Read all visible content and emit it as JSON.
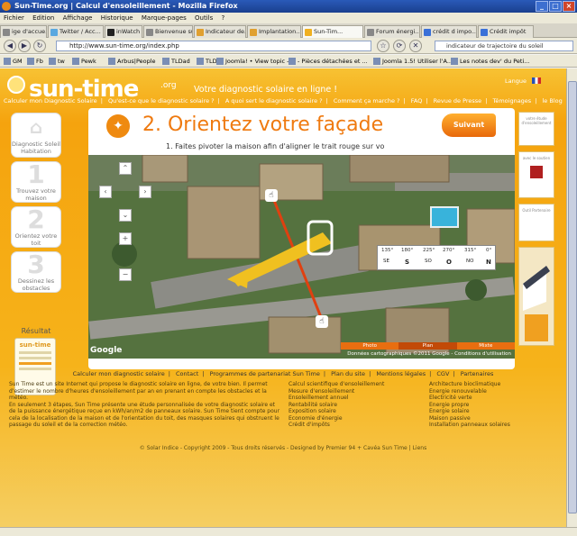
{
  "window": {
    "title": "Sun-Time.org | Calcul d'ensoleillement - Mozilla Firefox"
  },
  "menu": [
    "Fichier",
    "Edition",
    "Affichage",
    "Historique",
    "Marque-pages",
    "Outils",
    "?"
  ],
  "tabs": [
    "ige d'accue...",
    "Twitter / Acc...",
    "inWatch",
    "Bienvenue su...",
    "Indicateur de...",
    "Implantation...",
    "Sun-Tim...",
    "Forum énergi...",
    "crédit d impo...",
    "Crédit impôt"
  ],
  "url": "http://www.sun-time.org/index.php",
  "search": "indicateur de trajectoire du soleil",
  "bookmarks": [
    "GM",
    "Fb",
    "tw",
    "Pewk",
    "Arbus|People",
    "TLDad",
    "TLD",
    "Joomla! • View topic -...",
    "- Pièces détachées et ...",
    "Joomla 1.5! Utiliser l'A...",
    "Les notes dev' du Peti..."
  ],
  "site": {
    "logo": "sun-time",
    "logo_org": ".org",
    "tagline": "Votre diagnostic solaire en ligne !",
    "lang": "Langue",
    "nav": [
      "Calculer mon Diagnostic Solaire",
      "|",
      "Qu'est-ce que le diagnostic solaire ?",
      "|",
      "A quoi sert le diagnostic solaire ?",
      "|",
      "Comment ça marche ?",
      "|",
      "FAQ",
      "|",
      "Revue de Presse",
      "|",
      "Témoignages",
      "|",
      "le Blog"
    ]
  },
  "left": {
    "s0": "Diagnostic Soleil Habitation",
    "s1_num": "1",
    "s1": "Trouvez votre maison",
    "s2_num": "2",
    "s2": "Orientez votre toit",
    "s3_num": "3",
    "s3": "Dessinez les obstacles",
    "result": "Résultat",
    "card_brand": "sun-time"
  },
  "main": {
    "step_title": "2. Orientez votre façade",
    "instruction": "1. Faites pivoter la maison afin d'aligner le trait rouge sur vo",
    "next": "Suivant"
  },
  "map": {
    "ticks": [
      "135°",
      "180°",
      "225°",
      "270°",
      "315°",
      "0°"
    ],
    "cardinals": [
      "SE",
      "S",
      "SO",
      "O",
      "NO",
      "N"
    ],
    "tabs": [
      "Photo",
      "Plan",
      "Mixte"
    ],
    "copyright": "Données cartographiques ©2011 Google - Conditions d'utilisation",
    "google": "Google"
  },
  "right": {
    "box1": "votre étude d'ensoleillement",
    "box2": "avec le soutien",
    "box3": "Outil Partenaire"
  },
  "footer_links": [
    "Calculer mon diagnostic solaire",
    "|",
    "Contact",
    "|",
    "Programmes de partenariat Sun Time",
    "|",
    "Plan du site",
    "|",
    "Mentions légales",
    "|",
    "CGV",
    "|",
    "Partenaires"
  ],
  "info": {
    "col1": [
      "Sun Time est un site Internet qui propose le diagnostic solaire en ligne, de votre bien. Il permet",
      "d'estimer le nombre d'heures d'ensoleillement par an en prenant en compte les obstacles et la",
      "météo.",
      "En seulement 3 étapes, Sun Time présente une étude personnalisée de votre diagnostic solaire et",
      "de la puissance énergétique reçue en kWh/an/m2 de panneaux solaire. Sun Time tient compte pour",
      "cela de la localisation de la maison et de l'orientation du toit, des masques solaires qui obstruent le",
      "passage du soleil et de la correction météo."
    ],
    "col2": [
      "Calcul scientifique d'ensoleillement",
      "Mesure d'ensoleillement",
      "Ensoleillement annuel",
      "Rentabilité solaire",
      "Exposition solaire",
      "Economie d'énergie",
      "Crédit d'impôts"
    ],
    "col3": [
      "Architecture bioclimatique",
      "Energie renouvelable",
      "Electricité verte",
      "Energie propre",
      "Energie solaire",
      "Maison passive",
      "Installation panneaux solaires"
    ]
  },
  "copyright": "© Solar Indice - Copyright 2009 - Tous droits réservés - Designed by Premier 94 + Cavéa      Sun Time  |  Liens"
}
